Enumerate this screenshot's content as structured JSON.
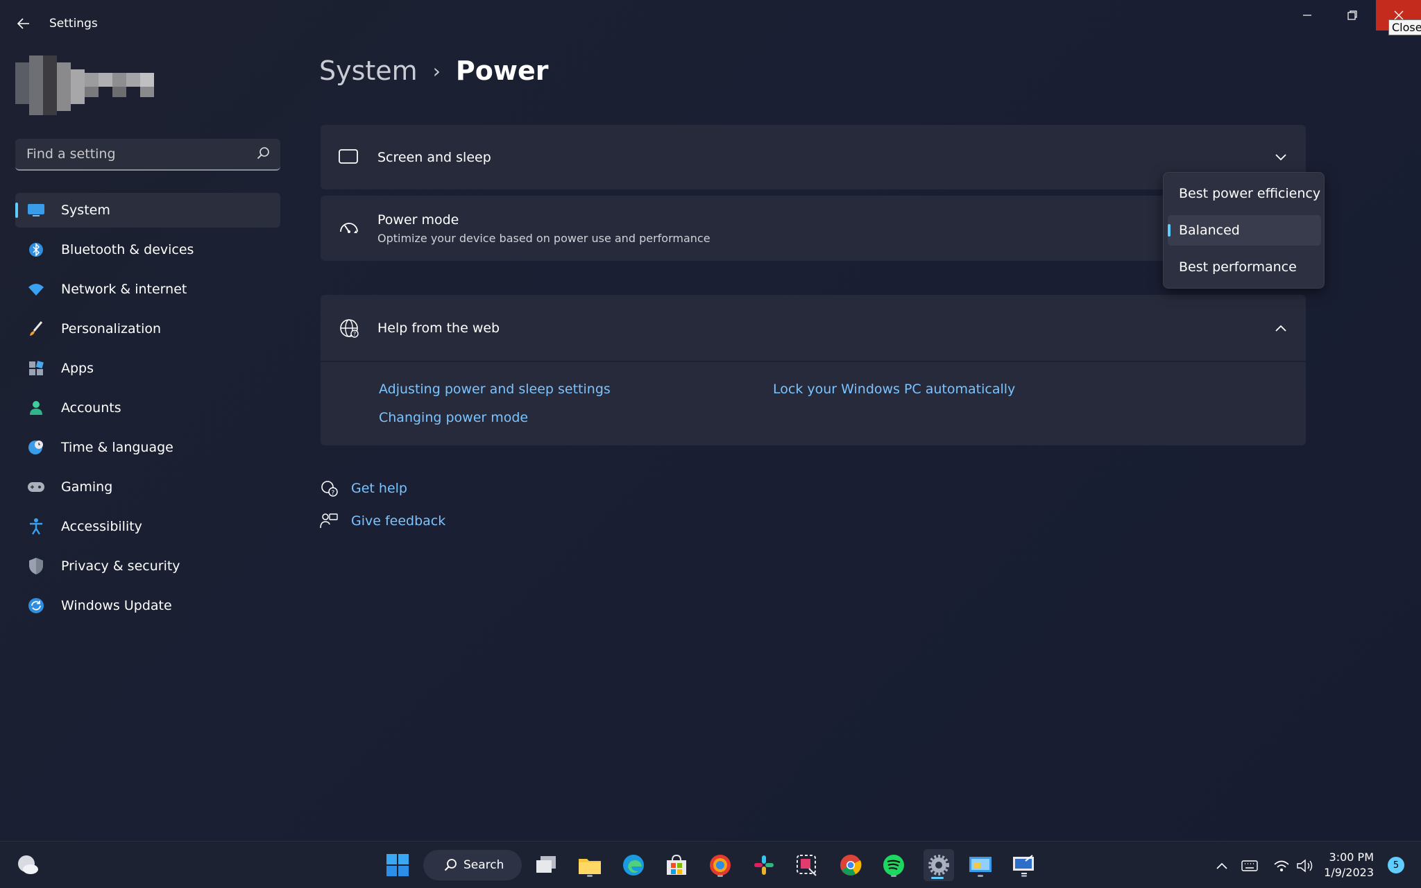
{
  "window": {
    "title": "Settings",
    "close_tooltip": "Close"
  },
  "search": {
    "placeholder": "Find a setting"
  },
  "sidebar": {
    "items": [
      {
        "label": "System",
        "icon": "monitor-icon",
        "active": true
      },
      {
        "label": "Bluetooth & devices",
        "icon": "bluetooth-icon"
      },
      {
        "label": "Network & internet",
        "icon": "wifi-icon"
      },
      {
        "label": "Personalization",
        "icon": "brush-icon"
      },
      {
        "label": "Apps",
        "icon": "apps-icon"
      },
      {
        "label": "Accounts",
        "icon": "person-icon"
      },
      {
        "label": "Time & language",
        "icon": "clock-globe-icon"
      },
      {
        "label": "Gaming",
        "icon": "gamepad-icon"
      },
      {
        "label": "Accessibility",
        "icon": "accessibility-icon"
      },
      {
        "label": "Privacy & security",
        "icon": "shield-icon"
      },
      {
        "label": "Windows Update",
        "icon": "update-icon"
      }
    ]
  },
  "breadcrumb": {
    "parent": "System",
    "separator": "›",
    "current": "Power"
  },
  "cards": {
    "screen_sleep": {
      "title": "Screen and sleep"
    },
    "power_mode": {
      "title": "Power mode",
      "subtitle": "Optimize your device based on power use and performance"
    },
    "help": {
      "title": "Help from the web",
      "links": [
        "Adjusting power and sleep settings",
        "Lock your Windows PC automatically",
        "Changing power mode"
      ]
    }
  },
  "power_mode_dropdown": {
    "options": [
      "Best power efficiency",
      "Balanced",
      "Best performance"
    ],
    "selected": "Balanced"
  },
  "bottom_links": {
    "get_help": "Get help",
    "give_feedback": "Give feedback"
  },
  "taskbar": {
    "search_label": "Search",
    "time": "3:00 PM",
    "date": "1/9/2023",
    "notification_count": "5"
  },
  "colors": {
    "accent": "#60cdff",
    "link": "#7cc4ff",
    "close": "#c42b1c"
  }
}
